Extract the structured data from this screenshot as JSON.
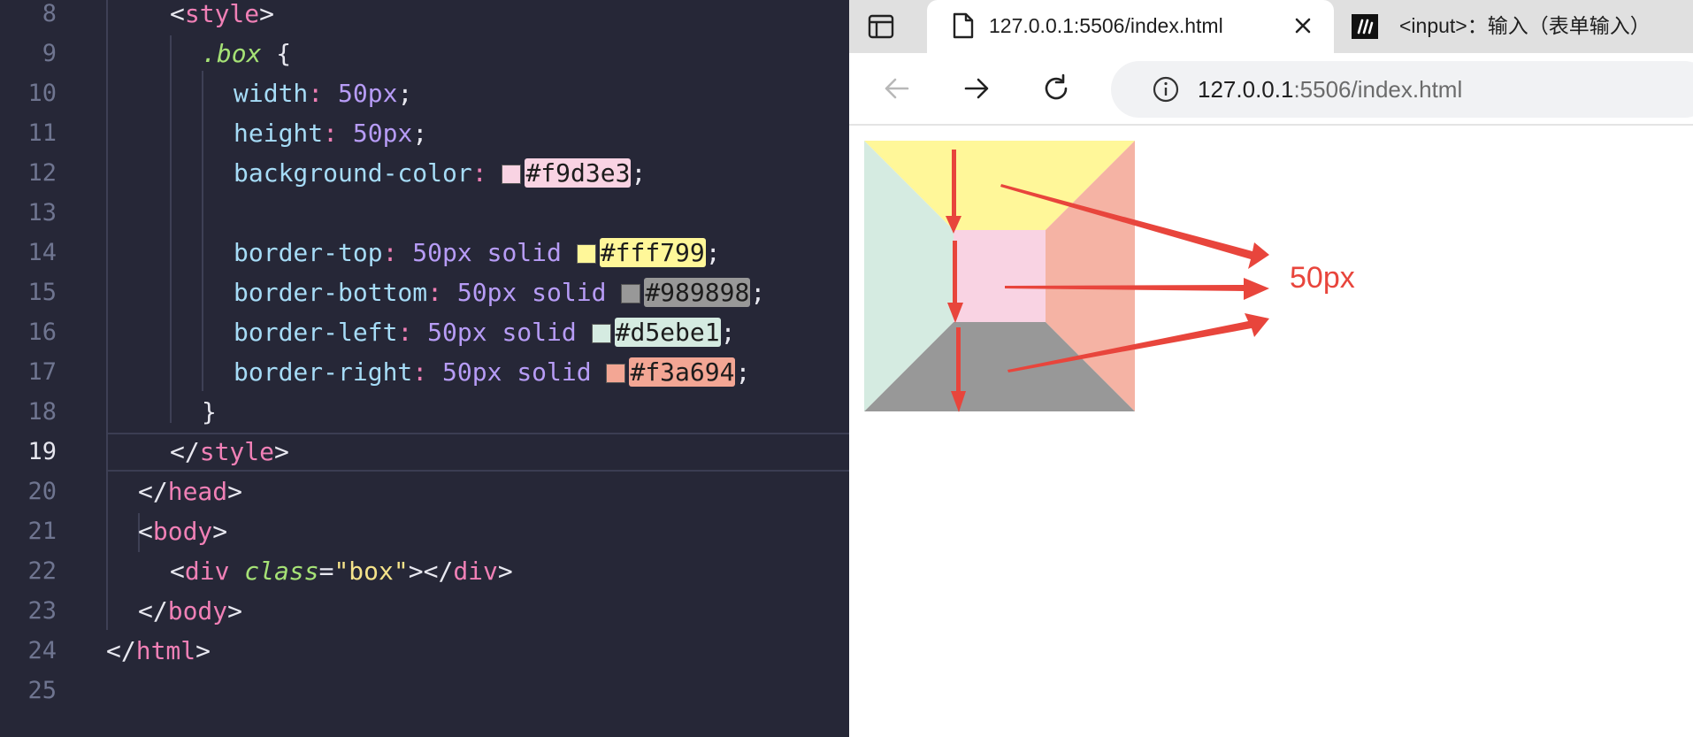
{
  "editor": {
    "lines": [
      {
        "num": "8"
      },
      {
        "num": "9"
      },
      {
        "num": "10"
      },
      {
        "num": "11"
      },
      {
        "num": "12"
      },
      {
        "num": "13"
      },
      {
        "num": "14"
      },
      {
        "num": "15"
      },
      {
        "num": "16"
      },
      {
        "num": "17"
      },
      {
        "num": "18"
      },
      {
        "num": "19"
      },
      {
        "num": "20"
      },
      {
        "num": "21"
      },
      {
        "num": "22"
      },
      {
        "num": "23"
      },
      {
        "num": "24"
      },
      {
        "num": "25"
      }
    ],
    "active_line": "19",
    "code": {
      "style_open": "style",
      "selector": ".box",
      "brace_open": "{",
      "brace_close": "}",
      "width_prop": "width",
      "width_val": "50px",
      "height_prop": "height",
      "height_val": "50px",
      "bg_prop": "background-color",
      "bg_hex": "#f9d3e3",
      "bt_prop": "border-top",
      "bt_size": "50px",
      "bt_style": "solid",
      "bt_hex": "#fff799",
      "bb_prop": "border-bottom",
      "bb_size": "50px",
      "bb_style": "solid",
      "bb_hex": "#989898",
      "bl_prop": "border-left",
      "bl_size": "50px",
      "bl_style": "solid",
      "bl_hex": "#d5ebe1",
      "br_prop": "border-right",
      "br_size": "50px",
      "br_style": "solid",
      "br_hex": "#f3a694",
      "style_close": "style",
      "head_close": "head",
      "body_open": "body",
      "div_tag": "div",
      "class_attr": "class",
      "class_val": "\"box\"",
      "body_close": "body",
      "html_close": "html"
    }
  },
  "browser": {
    "tabs": [
      {
        "title": "127.0.0.1:5506/index.html",
        "active": true
      },
      {
        "title": "<input>：输入（表单输入）",
        "active": false
      }
    ],
    "url_host": "127.0.0.1",
    "url_path": ":5506/index.html",
    "annotation": "50px"
  },
  "colors": {
    "box_bg": "#f9d3e3",
    "border_top": "#fff799",
    "border_bottom": "#989898",
    "border_left": "#d5ebe1",
    "border_right": "#f3a694",
    "arrow": "#e8453c",
    "editor_bg": "#262737"
  },
  "icons": {
    "sidebar": "sidebar-icon",
    "page": "page-icon",
    "close": "close-icon",
    "mdn": "mdn-logo-icon",
    "back": "back-arrow-icon",
    "forward": "forward-arrow-icon",
    "reload": "reload-icon",
    "info": "info-icon"
  }
}
